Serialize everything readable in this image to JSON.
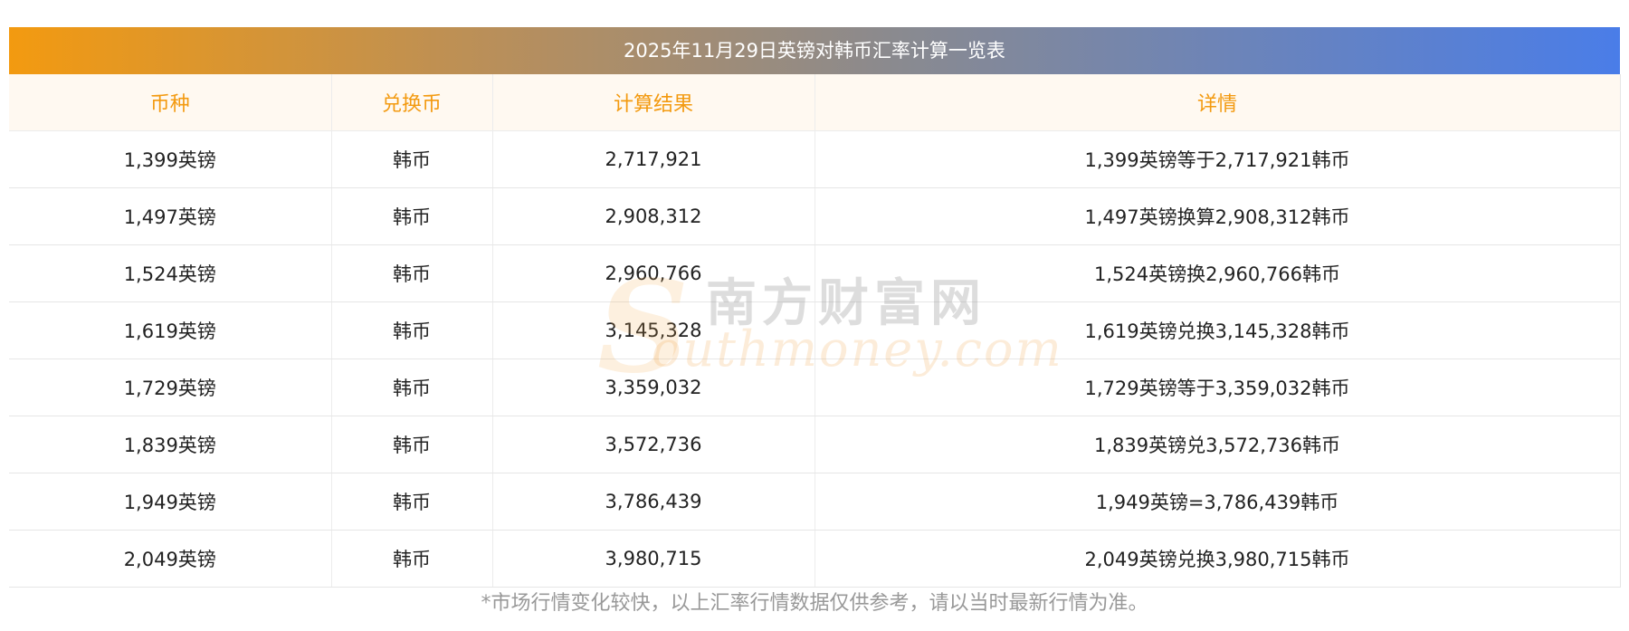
{
  "title": "2025年11月29日英镑对韩币汇率计算一览表",
  "headers": [
    "币种",
    "兑换币",
    "计算结果",
    "详情"
  ],
  "rows": [
    {
      "currency": "1,399英镑",
      "target": "韩币",
      "result": "2,717,921",
      "detail": "1,399英镑等于2,717,921韩币"
    },
    {
      "currency": "1,497英镑",
      "target": "韩币",
      "result": "2,908,312",
      "detail": "1,497英镑换算2,908,312韩币"
    },
    {
      "currency": "1,524英镑",
      "target": "韩币",
      "result": "2,960,766",
      "detail": "1,524英镑换2,960,766韩币"
    },
    {
      "currency": "1,619英镑",
      "target": "韩币",
      "result": "3,145,328",
      "detail": "1,619英镑兑换3,145,328韩币"
    },
    {
      "currency": "1,729英镑",
      "target": "韩币",
      "result": "3,359,032",
      "detail": "1,729英镑等于3,359,032韩币"
    },
    {
      "currency": "1,839英镑",
      "target": "韩币",
      "result": "3,572,736",
      "detail": "1,839英镑兑3,572,736韩币"
    },
    {
      "currency": "1,949英镑",
      "target": "韩币",
      "result": "3,786,439",
      "detail": "1,949英镑=3,786,439韩币"
    },
    {
      "currency": "2,049英镑",
      "target": "韩币",
      "result": "3,980,715",
      "detail": "2,049英镑兑换3,980,715韩币"
    }
  ],
  "watermark": {
    "cn": "南方财富网",
    "en_initial": "S",
    "en": "outhmoney.com"
  },
  "note": "*市场行情变化较快，以上汇率行情数据仅供参考，请以当时最新行情为准。",
  "colors": {
    "header_text": "#f39a10",
    "header_bg": "#fff9f1",
    "gradient_start": "#f39a10",
    "gradient_end": "#4a7de8"
  }
}
